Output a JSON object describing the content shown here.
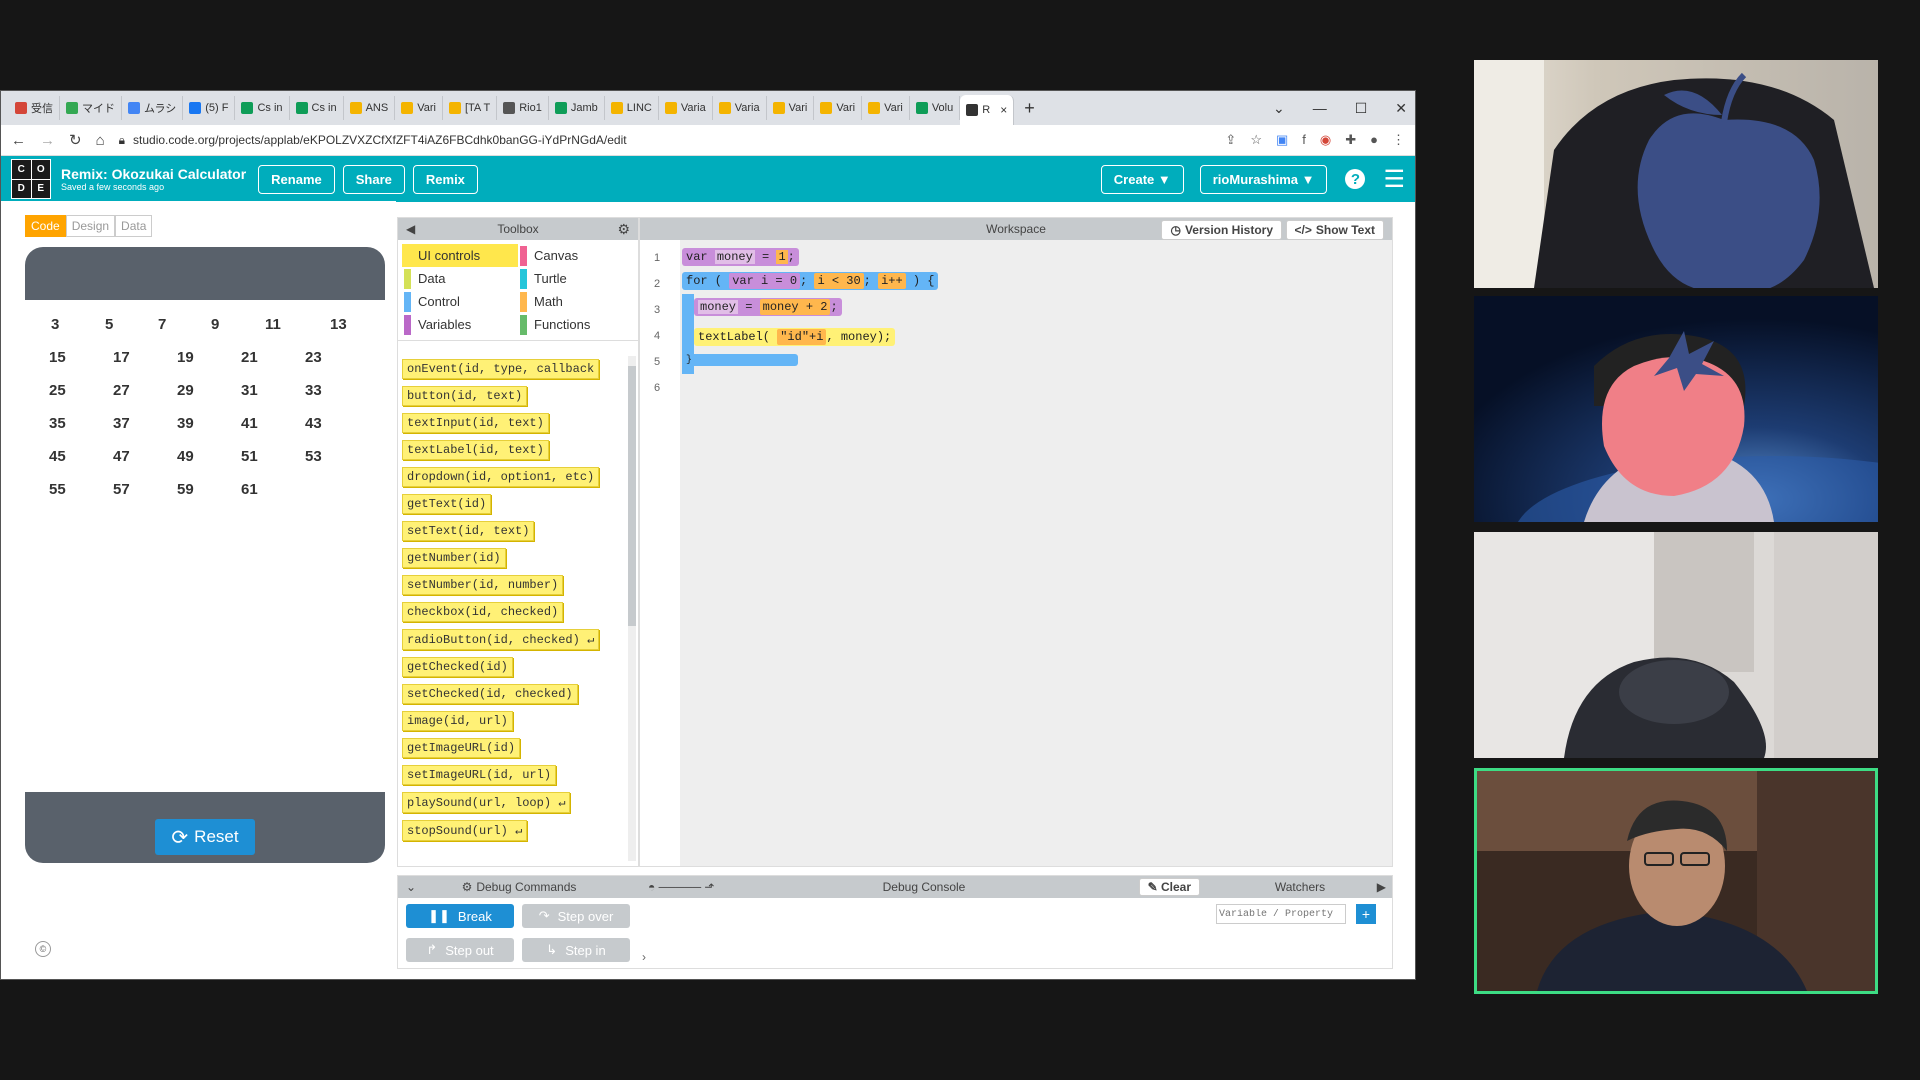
{
  "tabs": [
    {
      "label": "受信",
      "color": "#d44638"
    },
    {
      "label": "マイド",
      "color": "#34a853"
    },
    {
      "label": "ムラシ",
      "color": "#4285f4"
    },
    {
      "label": "(5) F",
      "color": "#1877f2"
    },
    {
      "label": "Cs in",
      "color": "#0f9d58"
    },
    {
      "label": "Cs in",
      "color": "#0f9d58"
    },
    {
      "label": "ANS",
      "color": "#f4b400"
    },
    {
      "label": "Vari",
      "color": "#f4b400"
    },
    {
      "label": "[TA T",
      "color": "#f4b400"
    },
    {
      "label": "Rio1",
      "color": "#555555"
    },
    {
      "label": "Jamb",
      "color": "#0f9d58"
    },
    {
      "label": "LINC",
      "color": "#f4b400"
    },
    {
      "label": "Varia",
      "color": "#f4b400"
    },
    {
      "label": "Varia",
      "color": "#f4b400"
    },
    {
      "label": "Vari",
      "color": "#f4b400"
    },
    {
      "label": "Vari",
      "color": "#f4b400"
    },
    {
      "label": "Vari",
      "color": "#f4b400"
    },
    {
      "label": "Volu",
      "color": "#0f9d58"
    }
  ],
  "active_tab": {
    "label": "R",
    "close": "×"
  },
  "new_tab": "+",
  "window_controls": {
    "chevron": "⌄",
    "minimize": "—",
    "maximize": "☐",
    "close": "✕"
  },
  "url": "studio.code.org/projects/applab/eKPOLZVXZCfXfZFT4iAZ6FBCdhk0banGG-iYdPrNGdA/edit",
  "header": {
    "logo": [
      "C",
      "O",
      "D",
      "E"
    ],
    "project_name": "Remix: Okozukai Calculator",
    "saved_status": "Saved a few seconds ago",
    "rename": "Rename",
    "share": "Share",
    "remix": "Remix",
    "create": "Create ▼",
    "user": "rioMurashima ▼",
    "help": "?",
    "menu": "☰"
  },
  "mode_tabs": {
    "code": "Code",
    "design": "Design",
    "data": "Data"
  },
  "app_numbers": [
    [
      "3",
      "5",
      "7",
      "9",
      "11",
      "13"
    ],
    [
      "15",
      "17",
      "19",
      "21",
      "23"
    ],
    [
      "25",
      "27",
      "29",
      "31",
      "33"
    ],
    [
      "35",
      "37",
      "39",
      "41",
      "43"
    ],
    [
      "45",
      "47",
      "49",
      "51",
      "53"
    ],
    [
      "55",
      "57",
      "59",
      "61"
    ]
  ],
  "reset_label": "Reset",
  "copyright": "©",
  "toolbox": {
    "title": "Toolbox",
    "categories": [
      {
        "label": "UI controls",
        "color": "#ffe74c",
        "selected": true
      },
      {
        "label": "Canvas",
        "color": "#f06292"
      },
      {
        "label": "Data",
        "color": "#d4e157"
      },
      {
        "label": "Turtle",
        "color": "#26c6da"
      },
      {
        "label": "Control",
        "color": "#64b5f6"
      },
      {
        "label": "Math",
        "color": "#ffb74d"
      },
      {
        "label": "Variables",
        "color": "#ba68c8"
      },
      {
        "label": "Functions",
        "color": "#66bb6a"
      }
    ],
    "blocks": [
      "onEvent(id, type, callback",
      "button(id, text)",
      "textInput(id, text)",
      "textLabel(id, text)",
      "dropdown(id, option1, etc)",
      "getText(id)",
      "setText(id, text)",
      "getNumber(id)",
      "setNumber(id, number)",
      "checkbox(id, checked)",
      "radioButton(id, checked) ↵",
      "getChecked(id)",
      "setChecked(id, checked)",
      "image(id, url)",
      "getImageURL(id)",
      "setImageURL(id, url)",
      "playSound(url, loop) ↵",
      "stopSound(url) ↵"
    ]
  },
  "workspace": {
    "title": "Workspace",
    "version_history": "Version History",
    "show_text": "Show Text",
    "line_numbers": [
      "1",
      "2",
      "3",
      "4",
      "5",
      "6"
    ],
    "code": {
      "l1_var": "var",
      "l1_name": "money",
      "l1_eq": "=",
      "l1_val": "1",
      "l2_for": "for (",
      "l2_init": "var i = 0",
      "l2_semi1": ";",
      "l2_cond": "i < 30",
      "l2_semi2": ";",
      "l2_inc": "i++",
      "l2_close": ") {",
      "l3_money": "money",
      "l3_eq": "=",
      "l3_expr": "money + 2",
      "l4_call": "textLabel(",
      "l4_arg1": "\"id\"+i",
      "l4_rest": ", money);",
      "l5_close": "}"
    }
  },
  "debug": {
    "commands_title": "Debug Commands",
    "console_title": "Debug Console",
    "clear": "Clear",
    "watchers_title": "Watchers",
    "watch_placeholder": "Variable / Property",
    "watch_add": "+",
    "break": "Break",
    "step_over": "Step over",
    "step_out": "Step out",
    "step_in": "Step in",
    "console_prompt": "›"
  },
  "colors": {
    "header": "#00adbc",
    "reset": "#1e8fd4",
    "active_speaker": "#3ddc84"
  }
}
